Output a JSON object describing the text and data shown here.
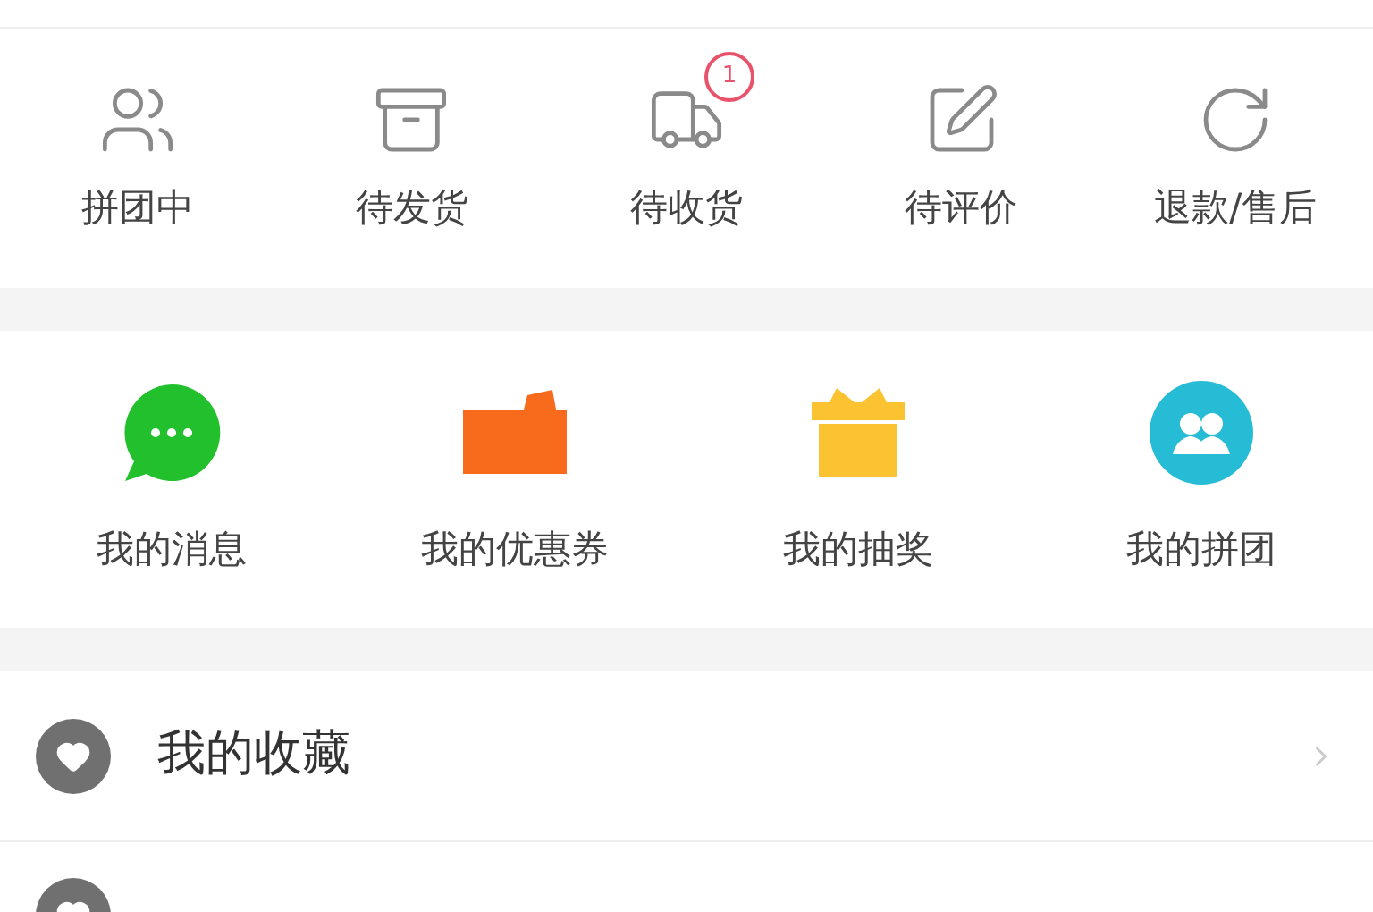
{
  "order_status": [
    {
      "label": "拼团中"
    },
    {
      "label": "待发货"
    },
    {
      "label": "待收货",
      "badge": "1"
    },
    {
      "label": "待评价"
    },
    {
      "label": "退款/售后"
    }
  ],
  "services": [
    {
      "label": "我的消息",
      "color": "#22c02c"
    },
    {
      "label": "我的优惠券",
      "color": "#f86a1c"
    },
    {
      "label": "我的抽奖",
      "color": "#fbc332"
    },
    {
      "label": "我的拼团",
      "color": "#26bcd5"
    }
  ],
  "menu": [
    {
      "kind": "full",
      "label": "我的收藏"
    },
    {
      "kind": "cut"
    }
  ]
}
